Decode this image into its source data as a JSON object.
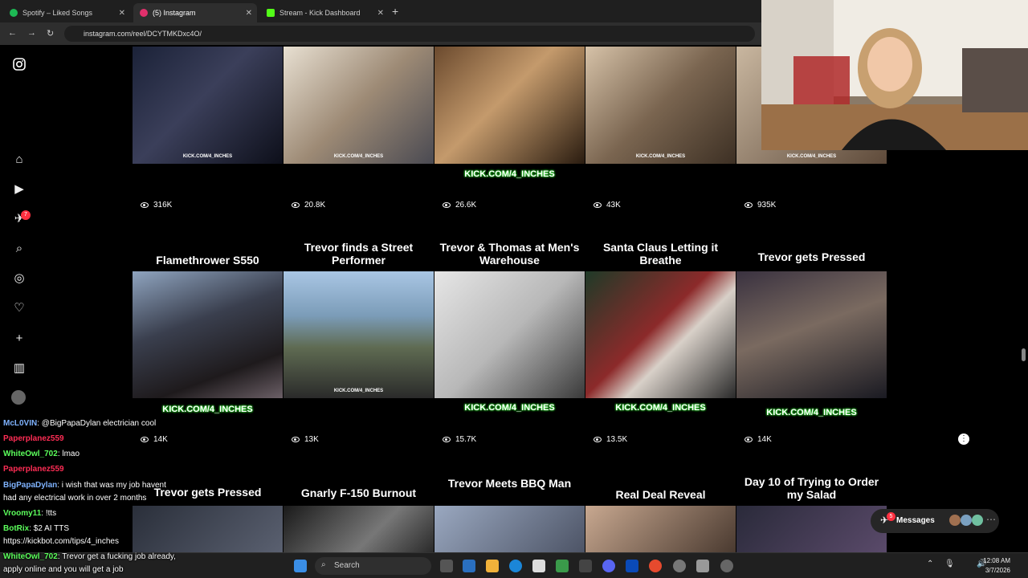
{
  "tabs": [
    {
      "label": "Spotify – Liked Songs",
      "color": "#1db954"
    },
    {
      "label": "(5) Instagram",
      "color": "#e1306c"
    },
    {
      "label": "Stream - Kick Dashboard",
      "color": "#53fc18"
    }
  ],
  "address": {
    "url": "instagram.com/reel/DCYTMKDxc4O/"
  },
  "sidebar": {
    "notif_badge": "7"
  },
  "reels_row1": [
    {
      "views": "316K",
      "kick": ""
    },
    {
      "views": "20.8K",
      "kick": ""
    },
    {
      "views": "26.6K",
      "kick": "KICK.COM/4_INCHES"
    },
    {
      "views": "43K",
      "kick": ""
    },
    {
      "views": "935K",
      "kick": ""
    }
  ],
  "reels_row2": [
    {
      "title": "Flamethrower S550",
      "views": "14K",
      "kick": "KICK.COM/4_INCHES"
    },
    {
      "title": "Trevor finds a Street Performer",
      "views": "13K",
      "kick": ""
    },
    {
      "title": "Trevor & Thomas at Men's Warehouse",
      "views": "15.7K",
      "kick": "KICK.COM/4_INCHES"
    },
    {
      "title": "Santa Claus Letting it Breathe",
      "views": "13.5K",
      "kick": "KICK.COM/4_INCHES"
    },
    {
      "title": "Trevor gets Pressed",
      "views": "14K",
      "kick": "KICK.COM/4_INCHES"
    }
  ],
  "reels_row3": [
    {
      "title": "Trevor gets Pressed"
    },
    {
      "title": "Gnarly F-150 Burnout"
    },
    {
      "title": "Trevor Meets BBQ Man"
    },
    {
      "title": "Real Deal Reveal"
    },
    {
      "title": "Day 10 of Trying to Order my Salad"
    }
  ],
  "watermark": "KICK.COM/4_INCHES",
  "chat": [
    {
      "name": "McL0VIN",
      "color": "#7fb3ff",
      "text": ": @BigPapaDylan electrician cool"
    },
    {
      "name": "Paperplanez559",
      "color": "#ff2d55",
      "text": ""
    },
    {
      "name": "WhiteOwl_702",
      "color": "#5cff5c",
      "text": ": lmao"
    },
    {
      "name": "Paperplanez559",
      "color": "#ff2d55",
      "text": ""
    },
    {
      "name": "BigPapaDylan",
      "color": "#7fb3ff",
      "text": ": i wish that was my job havent"
    },
    {
      "name": "",
      "color": "#fff",
      "text": "had any electrical work in over 2 months"
    },
    {
      "name": "Vroomy11",
      "color": "#5cff5c",
      "text": ": !tts"
    },
    {
      "name": "BotRix",
      "color": "#5cff5c",
      "text": ": $2 AI TTS"
    },
    {
      "name": "",
      "color": "#fff",
      "text": "https://kickbot.com/tips/4_inches"
    },
    {
      "name": "WhiteOwl_702",
      "color": "#5cff5c",
      "text": ": Trevor get a fucking job already,"
    },
    {
      "name": "",
      "color": "#fff",
      "text": "apply online and you will get a job"
    }
  ],
  "messages": {
    "label": "Messages",
    "count": "5"
  },
  "taskbar": {
    "search": "Search",
    "time": "12:08 AM",
    "date": "3/7/2026"
  }
}
